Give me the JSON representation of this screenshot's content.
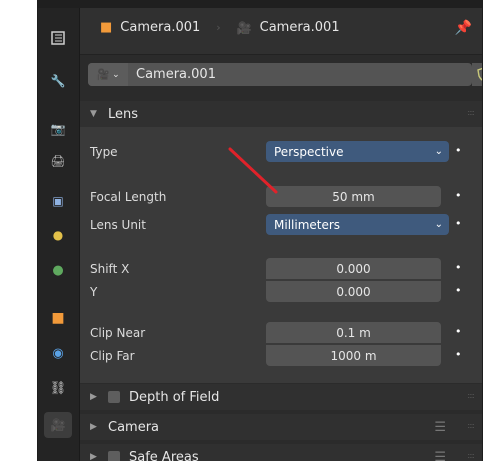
{
  "header": {
    "object_name": "Camera.001",
    "camera_data_name": "Camera.001"
  },
  "datablock": {
    "name": "Camera.001"
  },
  "lens_panel": {
    "title": "Lens",
    "type_label": "Type",
    "type_value": "Perspective",
    "focal_length_label": "Focal Length",
    "focal_length_value": "50 mm",
    "lens_unit_label": "Lens Unit",
    "lens_unit_value": "Millimeters",
    "shift_x_label": "Shift X",
    "shift_x_value": "0.000",
    "shift_y_label": "Y",
    "shift_y_value": "0.000",
    "clip_near_label": "Clip Near",
    "clip_near_value": "0.1 m",
    "clip_far_label": "Clip Far",
    "clip_far_value": "1000 m"
  },
  "panels": {
    "depth_of_field": "Depth of Field",
    "camera": "Camera",
    "safe_areas": "Safe Areas"
  },
  "icons": {
    "tabs": [
      "tool-icon",
      "render-icon",
      "output-icon",
      "view-layer-icon",
      "scene-icon",
      "world-icon",
      "object-icon",
      "physics-icon",
      "constraints-icon",
      "camera-data-icon"
    ],
    "annotation_color": "#e0222a"
  }
}
